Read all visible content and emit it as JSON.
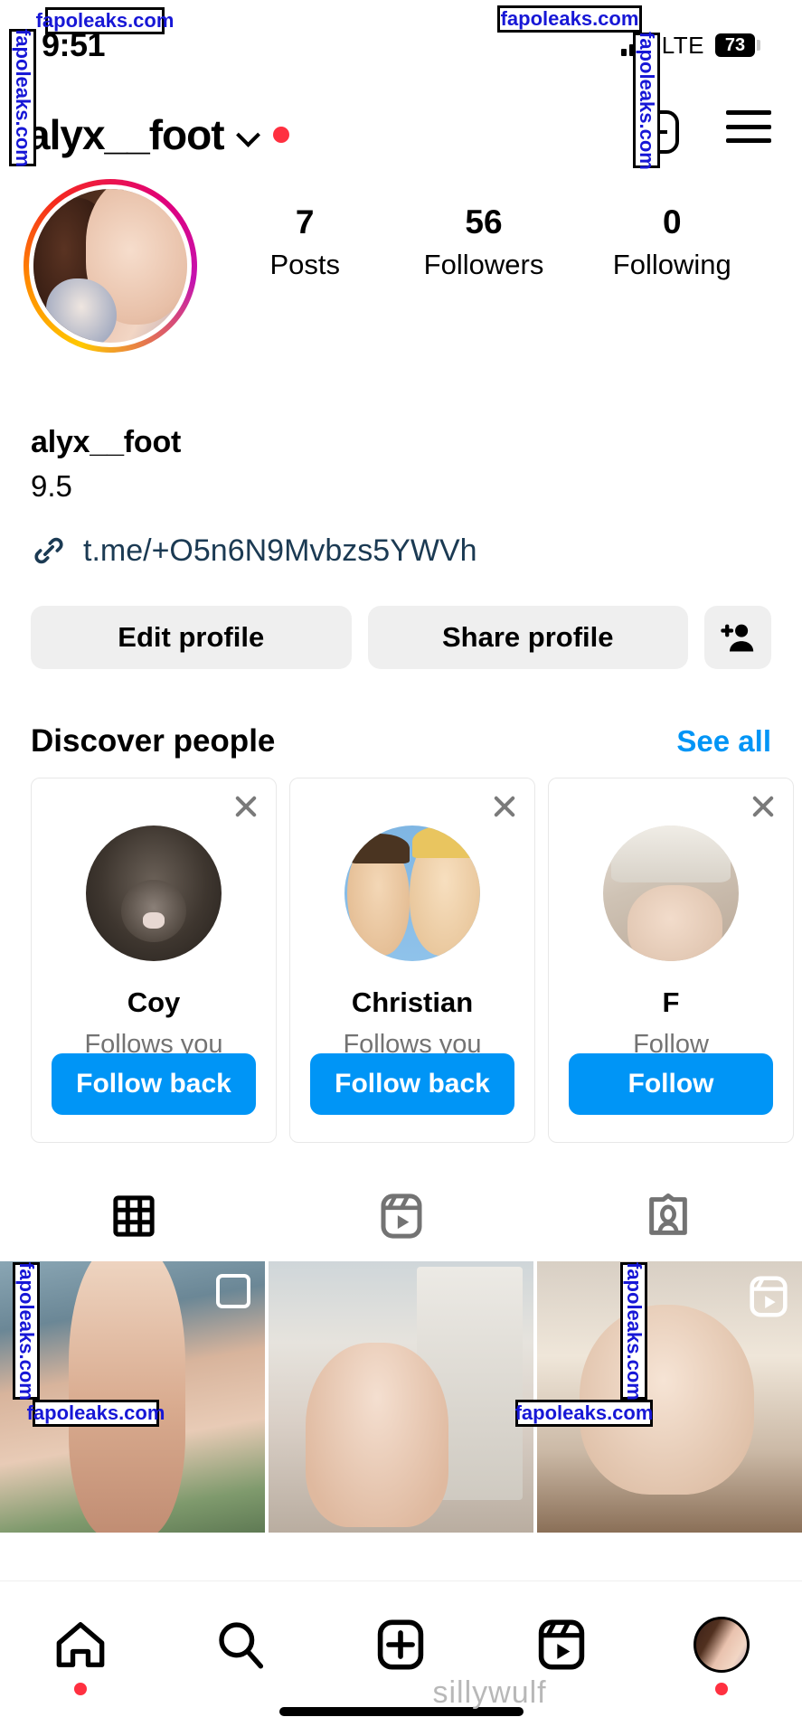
{
  "status_bar": {
    "time": "9:51",
    "network": "LTE",
    "battery": "73",
    "signal_icon": "signal-bars-icon"
  },
  "header": {
    "username": "alyx__foot",
    "chevron_icon": "chevron-down-icon",
    "unread_dot": "red-dot-indicator",
    "new_post_icon": "plus-square-icon",
    "menu_icon": "hamburger-menu-icon"
  },
  "profile": {
    "avatar_icon": "profile-avatar-story-ring",
    "stats": [
      {
        "num": "7",
        "label": "Posts"
      },
      {
        "num": "56",
        "label": "Followers"
      },
      {
        "num": "0",
        "label": "Following"
      }
    ],
    "display_name": "alyx__foot",
    "bio": "9.5",
    "link_icon": "link-chain-icon",
    "link": "t.me/+O5n6N9Mvbzs5YWVh"
  },
  "actions": {
    "edit_profile": "Edit profile",
    "share_profile": "Share profile",
    "add_person_icon": "person-add-icon"
  },
  "discover": {
    "title": "Discover people",
    "see_all": "See all",
    "cards": [
      {
        "name": "Coy",
        "sub": "Follows you",
        "button": "Follow back",
        "avatar_icon": "rat-avatar",
        "close_icon": "close-icon"
      },
      {
        "name": "Christian",
        "sub": "Follows you",
        "button": "Follow back",
        "avatar_icon": "beavis-butthead-avatar",
        "close_icon": "close-icon"
      },
      {
        "name": "F",
        "sub": "Follow",
        "button": "Follow",
        "avatar_icon": "feet-avatar",
        "close_icon": "close-icon"
      }
    ]
  },
  "content_tabs": [
    {
      "icon": "grid-icon",
      "active": true
    },
    {
      "icon": "reels-icon",
      "active": false
    },
    {
      "icon": "tagged-person-icon",
      "active": false
    }
  ],
  "posts": [
    {
      "badge": "multi-photo-icon"
    },
    {
      "badge": ""
    },
    {
      "badge": "reels-icon"
    }
  ],
  "bottom_nav": [
    {
      "icon": "home-icon",
      "dot": true
    },
    {
      "icon": "search-icon",
      "dot": false
    },
    {
      "icon": "create-plus-icon",
      "dot": false
    },
    {
      "icon": "reels-icon",
      "dot": false
    },
    {
      "icon": "profile-avatar-icon",
      "dot": true
    }
  ],
  "watermarks": {
    "site": "fapoleaks.com",
    "bottom_text": "sillywulf"
  },
  "colors": {
    "instagram_blue": "#0095F6",
    "notification_red": "#FF3040",
    "button_grey": "#EFEFEF",
    "link_navy": "#1B3A53",
    "muted_text": "#737373"
  }
}
